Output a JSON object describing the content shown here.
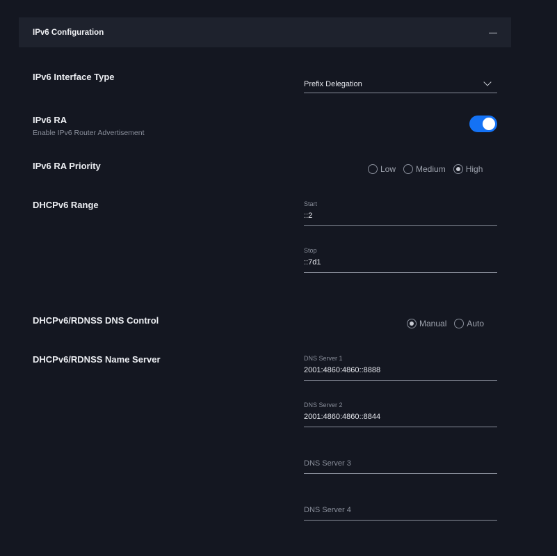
{
  "header": {
    "title": "IPv6 Configuration"
  },
  "interface_type": {
    "label": "IPv6 Interface Type",
    "value": "Prefix Delegation"
  },
  "ra": {
    "label": "IPv6 RA",
    "sublabel": "Enable IPv6 Router Advertisement",
    "enabled": true
  },
  "ra_priority": {
    "label": "IPv6 RA Priority",
    "options": [
      "Low",
      "Medium",
      "High"
    ],
    "selected": "High"
  },
  "dhcp_range": {
    "label": "DHCPv6 Range",
    "start": {
      "caption": "Start",
      "value": "::2"
    },
    "stop": {
      "caption": "Stop",
      "value": "::7d1"
    }
  },
  "dns_control": {
    "label": "DHCPv6/RDNSS DNS Control",
    "options": [
      "Manual",
      "Auto"
    ],
    "selected": "Manual"
  },
  "name_server": {
    "label": "DHCPv6/RDNSS Name Server",
    "servers": [
      {
        "caption": "DNS Server 1",
        "value": "2001:4860:4860::8888"
      },
      {
        "caption": "DNS Server 2",
        "value": "2001:4860:4860::8844"
      },
      {
        "placeholder": "DNS Server 3"
      },
      {
        "placeholder": "DNS Server 4"
      }
    ]
  },
  "colors": {
    "accent": "#1472f5",
    "background": "#141721",
    "header_bg": "#1e222d"
  }
}
